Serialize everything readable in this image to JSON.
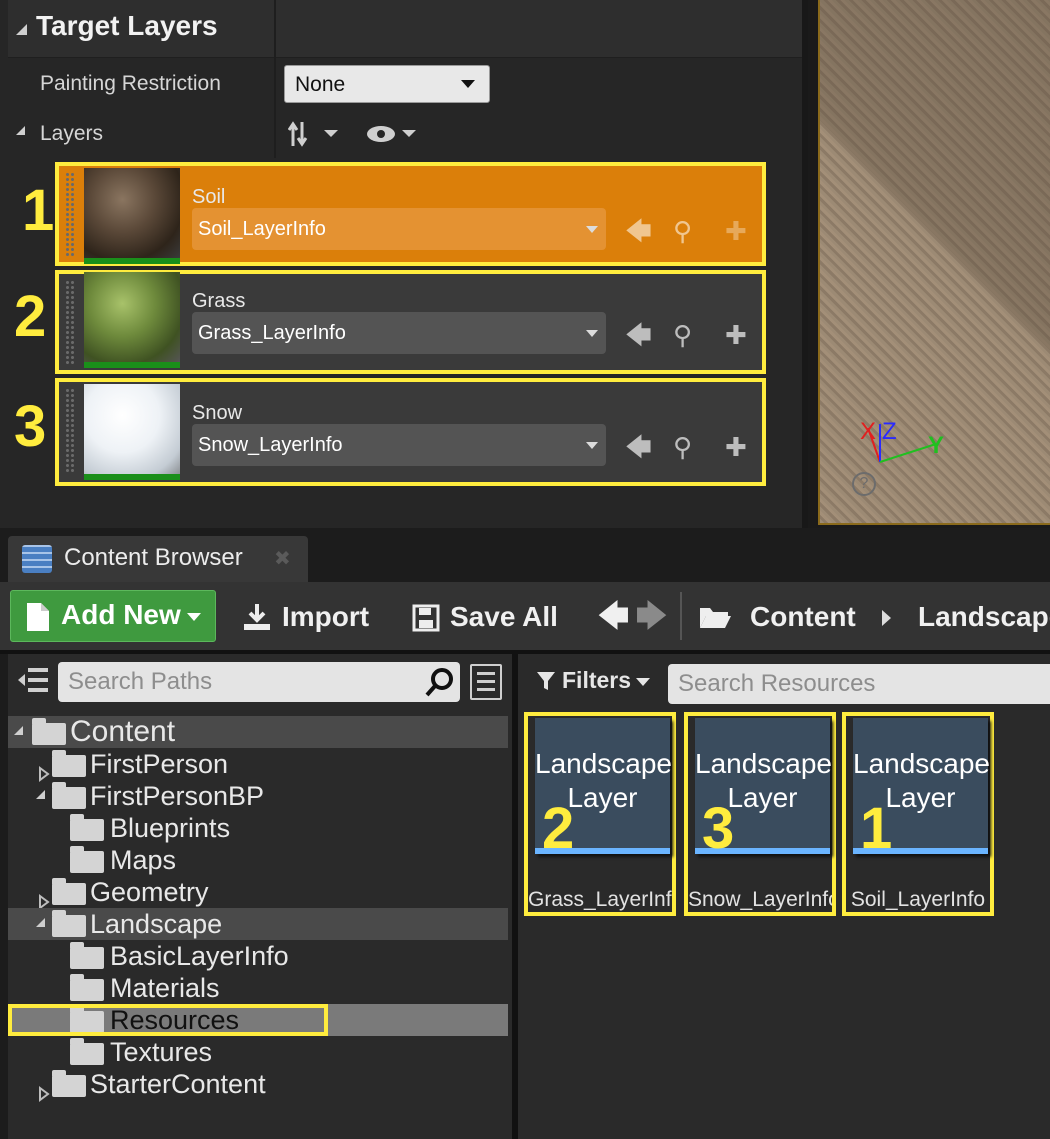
{
  "target_layers": {
    "title": "Target Layers",
    "painting_restriction_label": "Painting Restriction",
    "painting_restriction_value": "None",
    "layers_label": "Layers",
    "layers": [
      {
        "index": "1",
        "name": "Soil",
        "info": "Soil_LayerInfo",
        "selected": true
      },
      {
        "index": "2",
        "name": "Grass",
        "info": "Grass_LayerInfo",
        "selected": false
      },
      {
        "index": "3",
        "name": "Snow",
        "info": "Snow_LayerInfo",
        "selected": false
      }
    ]
  },
  "viewport": {
    "axis_x": "X",
    "axis_y": "Y",
    "axis_z": "Z"
  },
  "content_browser": {
    "tab_title": "Content Browser",
    "toolbar": {
      "add_new": "Add New",
      "import": "Import",
      "save_all": "Save All",
      "breadcrumb": [
        "Content",
        "Landscape"
      ]
    },
    "search_paths_placeholder": "Search Paths",
    "filters_label": "Filters",
    "search_resources_placeholder": "Search Resources",
    "tree": [
      {
        "label": "Content",
        "depth": 0,
        "expanded": true
      },
      {
        "label": "FirstPerson",
        "depth": 1,
        "expanded": false
      },
      {
        "label": "FirstPersonBP",
        "depth": 1,
        "expanded": true
      },
      {
        "label": "Blueprints",
        "depth": 2
      },
      {
        "label": "Maps",
        "depth": 2
      },
      {
        "label": "Geometry",
        "depth": 1,
        "expanded": false
      },
      {
        "label": "Landscape",
        "depth": 1,
        "expanded": true
      },
      {
        "label": "BasicLayerInfo",
        "depth": 2
      },
      {
        "label": "Materials",
        "depth": 2
      },
      {
        "label": "Resources",
        "depth": 2,
        "selected": true
      },
      {
        "label": "Textures",
        "depth": 2
      },
      {
        "label": "StarterContent",
        "depth": 1,
        "expanded": false
      }
    ],
    "assets": [
      {
        "type_line1": "Landscape",
        "type_line2": "Layer",
        "number": "2",
        "name": "Grass_LayerInfo"
      },
      {
        "type_line1": "Landscape",
        "type_line2": "Layer",
        "number": "3",
        "name": "Snow_LayerInfo"
      },
      {
        "type_line1": "Landscape",
        "type_line2": "Layer",
        "number": "1",
        "name": "Soil_LayerInfo"
      }
    ]
  },
  "colors": {
    "highlight": "#ffec3e",
    "selected_row": "#db7f0a",
    "add_new": "#3f9a3f",
    "asset_bar": "#6ab4ff"
  }
}
